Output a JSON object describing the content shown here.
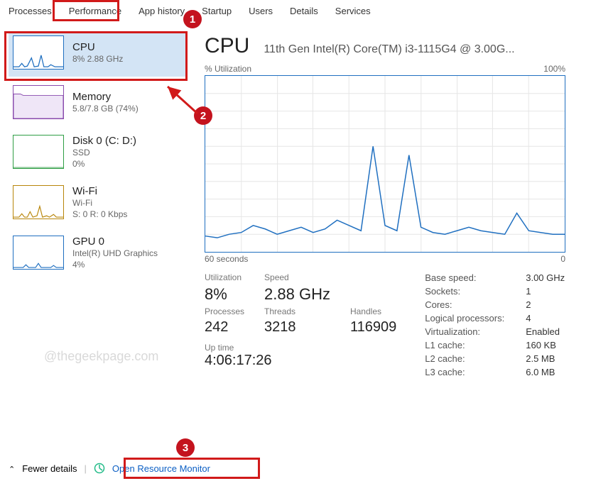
{
  "tabs": [
    "Processes",
    "Performance",
    "App history",
    "Startup",
    "Users",
    "Details",
    "Services"
  ],
  "active_tab_index": 1,
  "sidebar": [
    {
      "title": "CPU",
      "line1": "8%  2.88 GHz",
      "line2": "",
      "selected": true
    },
    {
      "title": "Memory",
      "line1": "5.8/7.8 GB (74%)",
      "line2": ""
    },
    {
      "title": "Disk 0 (C: D:)",
      "line1": "SSD",
      "line2": "0%"
    },
    {
      "title": "Wi-Fi",
      "line1": "Wi-Fi",
      "line2": "S: 0 R: 0 Kbps"
    },
    {
      "title": "GPU 0",
      "line1": "Intel(R) UHD Graphics",
      "line2": "4%"
    }
  ],
  "main": {
    "title": "CPU",
    "subtitle": "11th Gen Intel(R) Core(TM) i3-1115G4 @ 3.00G...",
    "chart_top_left": "% Utilization",
    "chart_top_right": "100%",
    "chart_bottom_left": "60 seconds",
    "chart_bottom_right": "0",
    "stats_left": [
      {
        "label": "Utilization",
        "value": "8%"
      },
      {
        "label": "Speed",
        "value": "2.88 GHz"
      },
      {
        "label": "",
        "value": ""
      },
      {
        "label": "Processes",
        "value": "242"
      },
      {
        "label": "Threads",
        "value": "3218"
      },
      {
        "label": "Handles",
        "value": "116909"
      }
    ],
    "uptime_label": "Up time",
    "uptime_value": "4:06:17:26",
    "stats_right": [
      {
        "label": "Base speed:",
        "value": "3.00 GHz"
      },
      {
        "label": "Sockets:",
        "value": "1"
      },
      {
        "label": "Cores:",
        "value": "2"
      },
      {
        "label": "Logical processors:",
        "value": "4"
      },
      {
        "label": "Virtualization:",
        "value": "Enabled"
      },
      {
        "label": "L1 cache:",
        "value": "160 KB"
      },
      {
        "label": "L2 cache:",
        "value": "2.5 MB"
      },
      {
        "label": "L3 cache:",
        "value": "6.0 MB"
      }
    ]
  },
  "footer": {
    "fewer": "Fewer details",
    "link": "Open Resource Monitor"
  },
  "watermark": "@thegeekpage.com",
  "annotations": {
    "c1": "1",
    "c2": "2",
    "c3": "3"
  },
  "chart_data": {
    "type": "line",
    "title": "CPU % Utilization",
    "xlabel": "seconds",
    "ylabel": "% Utilization",
    "xlim": [
      60,
      0
    ],
    "ylim": [
      0,
      100
    ],
    "x": [
      60,
      58,
      56,
      54,
      52,
      50,
      48,
      46,
      44,
      42,
      40,
      38,
      36,
      34,
      32,
      30,
      28,
      26,
      24,
      22,
      20,
      18,
      16,
      14,
      12,
      10,
      8,
      6,
      4,
      2,
      0
    ],
    "values": [
      9,
      8,
      10,
      11,
      15,
      13,
      10,
      12,
      14,
      11,
      13,
      18,
      15,
      12,
      60,
      15,
      12,
      55,
      14,
      11,
      10,
      12,
      14,
      12,
      11,
      10,
      22,
      12,
      11,
      10,
      10
    ]
  }
}
